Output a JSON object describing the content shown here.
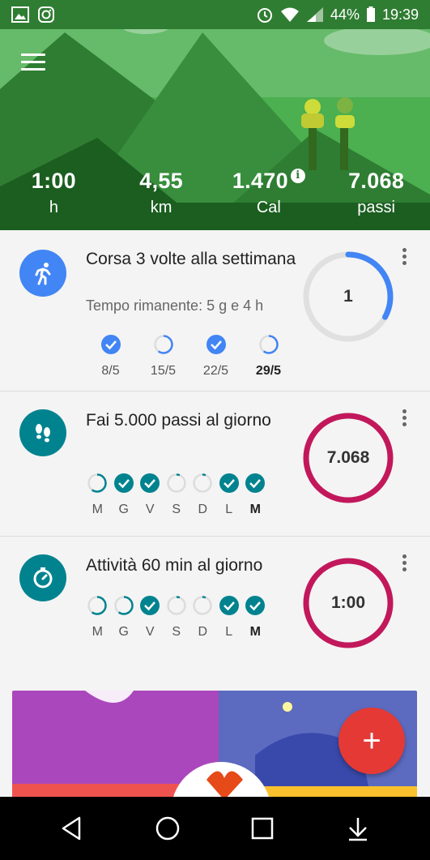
{
  "status_bar": {
    "battery": "44%",
    "time": "19:39"
  },
  "stats": [
    {
      "value": "1:00",
      "label": "h"
    },
    {
      "value": "4,55",
      "label": "km"
    },
    {
      "value": "1.470",
      "label": "Cal"
    },
    {
      "value": "7.068",
      "label": "passi"
    }
  ],
  "goals": [
    {
      "title": "Corsa 3 volte alla settimana",
      "subtitle": "Tempo rimanente: 5 g e 4 h",
      "ring_value": "1",
      "ring_color": "#4285f4",
      "ring_progress": 0.33,
      "days": [
        {
          "label": "8/5",
          "state": "done"
        },
        {
          "label": "15/5",
          "state": "partial"
        },
        {
          "label": "22/5",
          "state": "done"
        },
        {
          "label": "29/5",
          "state": "partial",
          "bold": true
        }
      ]
    },
    {
      "title": "Fai 5.000 passi al giorno",
      "ring_value": "7.068",
      "ring_color": "#c2185b",
      "ring_progress": 1.0,
      "days": [
        {
          "label": "M",
          "state": "partial"
        },
        {
          "label": "G",
          "state": "done"
        },
        {
          "label": "V",
          "state": "done"
        },
        {
          "label": "S",
          "state": "empty"
        },
        {
          "label": "D",
          "state": "empty"
        },
        {
          "label": "L",
          "state": "done"
        },
        {
          "label": "M",
          "state": "done",
          "bold": true
        }
      ]
    },
    {
      "title": "Attività 60 min al giorno",
      "ring_value": "1:00",
      "ring_color": "#c2185b",
      "ring_progress": 1.0,
      "days": [
        {
          "label": "M",
          "state": "partial"
        },
        {
          "label": "G",
          "state": "partial"
        },
        {
          "label": "V",
          "state": "done"
        },
        {
          "label": "S",
          "state": "empty"
        },
        {
          "label": "D",
          "state": "empty"
        },
        {
          "label": "L",
          "state": "done"
        },
        {
          "label": "M",
          "state": "done",
          "bold": true
        }
      ]
    }
  ],
  "colors": {
    "header_green": "#2e7d32",
    "goal_teal": "#00838f",
    "run_blue": "#4285f4",
    "fab_red": "#e53935"
  },
  "icons": {
    "menu": "hamburger-icon",
    "goal_1": "running-icon",
    "goal_2": "footsteps-icon",
    "goal_3": "timer-icon",
    "fab": "plus-icon"
  },
  "fab_label": "+"
}
